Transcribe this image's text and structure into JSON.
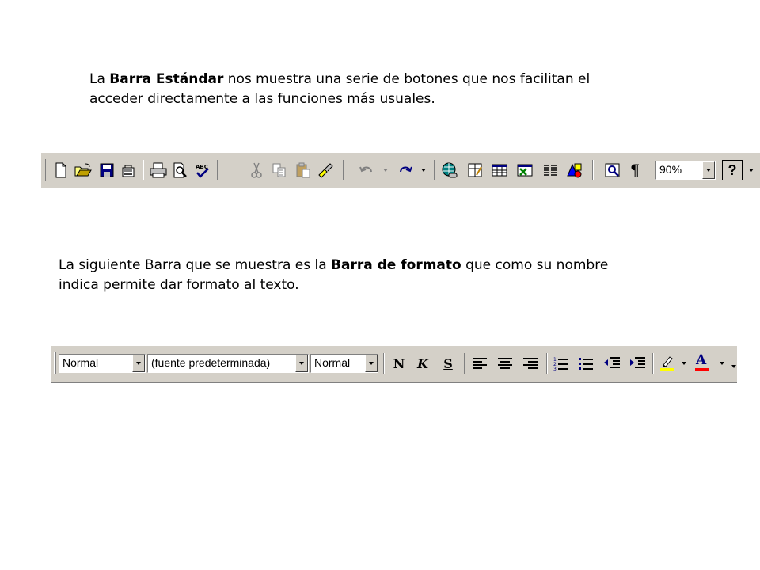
{
  "standard_caption": {
    "pre": "La ",
    "bold": "Barra Estándar",
    "post": " nos muestra una serie de botones que nos facilitan el acceder directamente a las funciones más usuales."
  },
  "format_caption": {
    "pre": "La siguiente Barra que se muestra es la ",
    "bold": "Barra de formato",
    "post": " que como su nombre indica permite dar formato al texto."
  },
  "standard_toolbar": {
    "zoom_value": "90%",
    "pilcrow_glyph": "¶",
    "help_glyph": "?",
    "buttons": [
      "new-document-icon",
      "open-folder-icon",
      "save-disk-icon",
      "permissions-icon",
      "print-icon",
      "print-preview-icon",
      "spelling-check-icon",
      "cut-scissors-icon",
      "copy-icon",
      "paste-icon",
      "format-painter-icon",
      "undo-icon",
      "redo-icon",
      "hyperlink-globe-icon",
      "tables-borders-icon",
      "insert-table-icon",
      "insert-excel-sheet-icon",
      "columns-icon",
      "drawing-icon",
      "document-map-icon",
      "show-hide-pilcrow-icon",
      "help-icon"
    ]
  },
  "format_toolbar": {
    "style_value": "Normal",
    "font_value": "(fuente predeterminada)",
    "size_value": "Normal",
    "bold_label": "N",
    "italic_label": "K",
    "underline_label": "S",
    "font_color_label": "A",
    "buttons": [
      "align-left-icon",
      "center-icon",
      "align-right-icon",
      "numbering-icon",
      "bullets-icon",
      "decrease-indent-icon",
      "increase-indent-icon",
      "highlight-icon",
      "font-color-icon"
    ]
  },
  "colors": {
    "toolbar_bg": "#d4d0c8",
    "highlight_yellow": "#ffff00",
    "font_color_red": "#ff0000",
    "excel_green": "#008000",
    "navy": "#000080"
  }
}
